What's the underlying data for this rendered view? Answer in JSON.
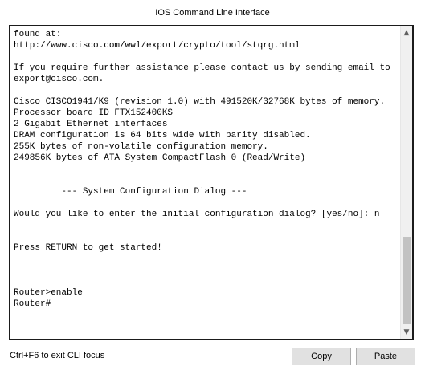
{
  "window": {
    "title": "IOS Command Line Interface"
  },
  "terminal": {
    "text": "found at:\nhttp://www.cisco.com/wwl/export/crypto/tool/stqrg.html\n\nIf you require further assistance please contact us by sending email to\nexport@cisco.com.\n\nCisco CISCO1941/K9 (revision 1.0) with 491520K/32768K bytes of memory.\nProcessor board ID FTX152400KS\n2 Gigabit Ethernet interfaces\nDRAM configuration is 64 bits wide with parity disabled.\n255K bytes of non-volatile configuration memory.\n249856K bytes of ATA System CompactFlash 0 (Read/Write)\n\n\n         --- System Configuration Dialog ---\n\nWould you like to enter the initial configuration dialog? [yes/no]: n\n\n\nPress RETURN to get started!\n\n\n\nRouter>enable\nRouter#"
  },
  "scrollbar": {
    "up_icon": "▲",
    "down_icon": "▼"
  },
  "footer": {
    "hint": "Ctrl+F6 to exit CLI focus",
    "copy_label": "Copy",
    "paste_label": "Paste"
  }
}
